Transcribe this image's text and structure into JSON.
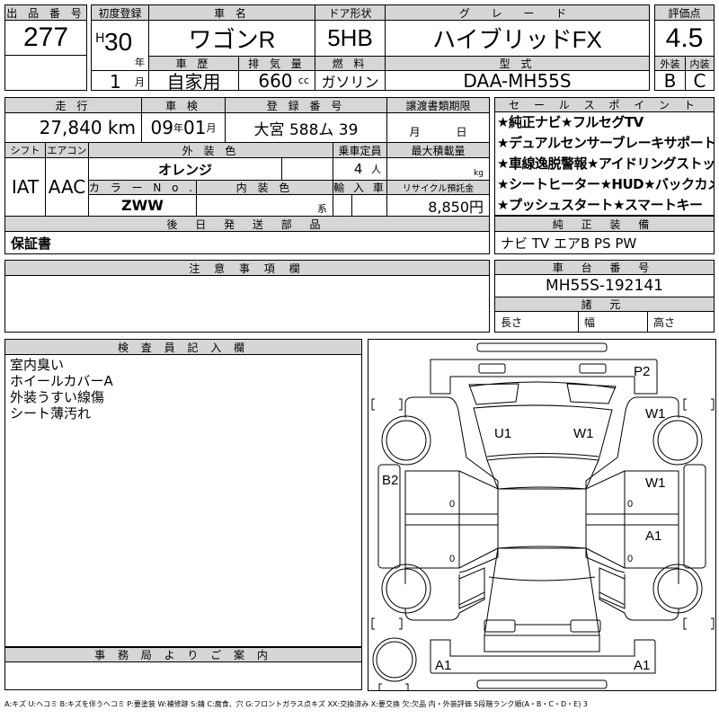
{
  "lot": {
    "label": "出 品 番 号",
    "value": "277"
  },
  "first_reg": {
    "label": "初度登録",
    "era": "H",
    "year": "30",
    "year_unit": "年",
    "month": "1",
    "month_unit": "月"
  },
  "car_name": {
    "label": "車 名",
    "value": "ワゴンR"
  },
  "door": {
    "label": "ドア形状",
    "value": "5HB"
  },
  "grade": {
    "label": "グ レ ー ド",
    "value": "ハイブリッドFX"
  },
  "score": {
    "label": "評価点",
    "value": "4.5",
    "ext_label": "外装",
    "int_label": "内装",
    "ext": "B",
    "int": "C"
  },
  "history": {
    "label": "車 歴",
    "value": "自家用"
  },
  "displacement": {
    "label": "排 気 量",
    "value": "660",
    "unit": "cc"
  },
  "fuel": {
    "label": "燃 料",
    "value": "ガソリン"
  },
  "model": {
    "label": "型 式",
    "value": "DAA-MH55S"
  },
  "mileage": {
    "label": "走 行",
    "value": "27,840 km"
  },
  "inspection": {
    "label": "車 検",
    "year": "09",
    "year_unit": "年",
    "month": "01",
    "month_unit": "月"
  },
  "plate": {
    "label": "登 録 番 号",
    "value": "大宮 588ム 39"
  },
  "transfer": {
    "label": "譲渡書類期限",
    "month_unit": "月",
    "day_unit": "日"
  },
  "shift": {
    "label": "シフト",
    "value": "IAT"
  },
  "aircon": {
    "label": "エアコン",
    "value": "AAC"
  },
  "ext_color": {
    "label": "外 装 色",
    "value": "オレンジ"
  },
  "capacity": {
    "label": "乗車定員",
    "value": "4",
    "unit": "人"
  },
  "max_load": {
    "label": "最大積載量",
    "unit": "kg"
  },
  "color_no": {
    "label": "カ ラ ー N o .",
    "value": "ZWW"
  },
  "int_color": {
    "label": "内 装 色",
    "unit": "系"
  },
  "import": {
    "label": "輸 入 車"
  },
  "recycle": {
    "label": "リサイクル預託金",
    "value": "8,850円"
  },
  "later_parts": {
    "label": "後 日 発 送 部 品",
    "value": "保証書"
  },
  "sales_points": {
    "label": "セ ー ル ス ポ イ ン ト",
    "lines": [
      "★純正ナビ★フルセグTV",
      "★デュアルセンサーブレーキサポート",
      "★車線逸脱警報★アイドリングストップ",
      "★シートヒーター★HUD★バックカメラ",
      "★プッシュスタート★スマートキー"
    ]
  },
  "equipment": {
    "label": "純 正 装 備",
    "value": "ナビ TV エアB PS PW"
  },
  "notes_box": {
    "label": "注 意 事 項 欄"
  },
  "chassis": {
    "label": "車 台 番 号",
    "value": "MH55S-192141"
  },
  "specs": {
    "label": "諸 元",
    "length": "長さ",
    "width": "幅",
    "height": "高さ"
  },
  "inspector": {
    "label": "検 査 員 記 入 欄",
    "lines": [
      "室内臭い",
      "ホイールカバーA",
      "外装うすい線傷",
      "シート薄汚れ"
    ]
  },
  "office": {
    "label": "事 務 局 よ り ご 案 内"
  },
  "diagram": {
    "marks": {
      "p2": "P2",
      "w1_front_right": "W1",
      "u1": "U1",
      "w1_roof": "W1",
      "b2": "B2",
      "w1_door": "W1",
      "a1_door": "A1",
      "a1_rear_left": "A1",
      "a1_rear_right": "A1",
      "zero": "0"
    }
  },
  "legend": "A:キズ U:ヘコミ B:キズを伴うヘコミ P:要塗装 W:補修跡 S:錆 C:腐食、穴 G:フロントガラス点キズ XX:交換済み X:要交換 欠:欠品 内・外装評価 5段階ランク順(A・B・C・D・E) 3"
}
